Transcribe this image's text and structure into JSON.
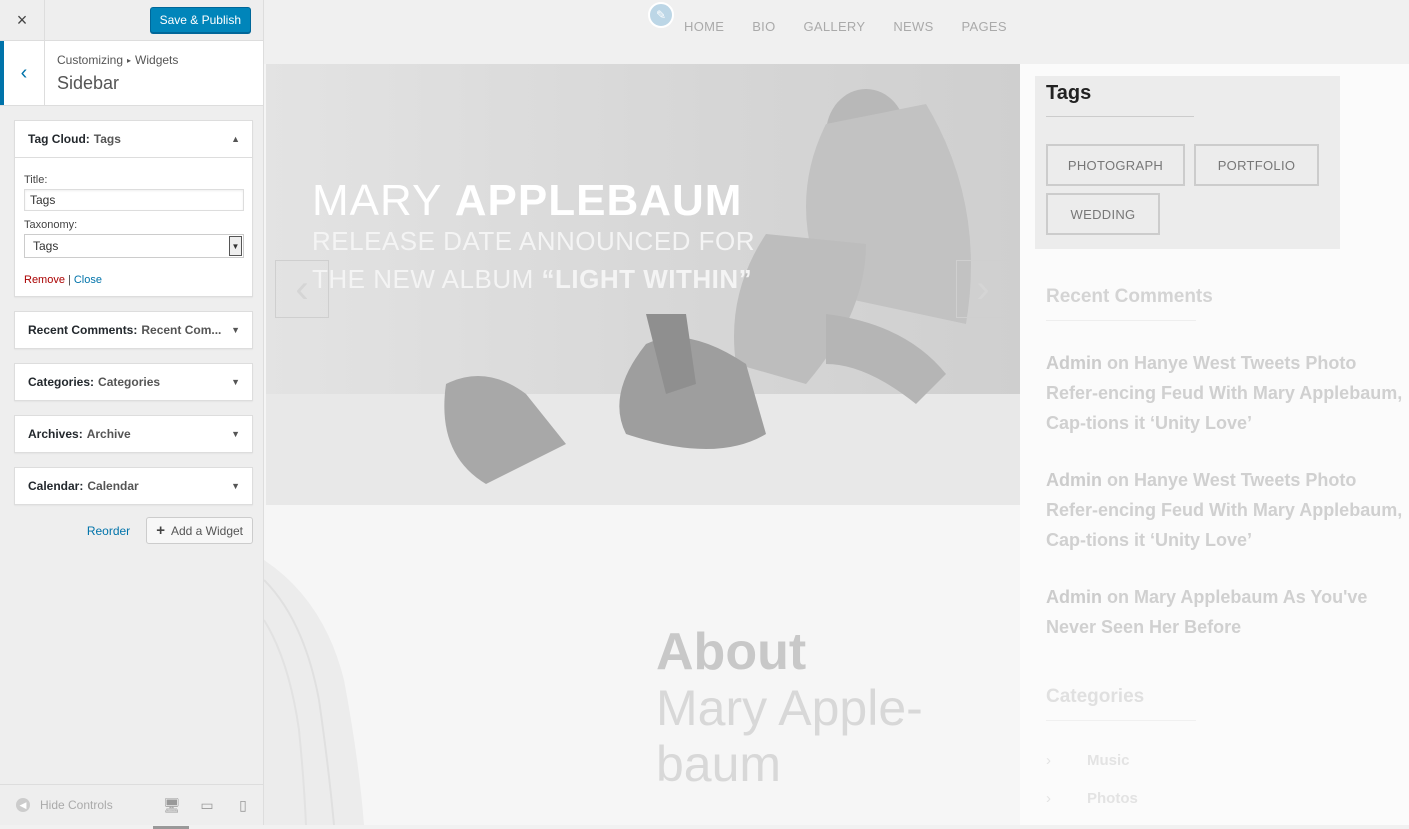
{
  "customizer": {
    "close_icon": "×",
    "save_label": "Save & Publish",
    "back_icon": "‹",
    "breadcrumb": {
      "root": "Customizing",
      "sep": "▸",
      "current": "Widgets"
    },
    "section_title": "Sidebar",
    "widgets": [
      {
        "type": "Tag Cloud",
        "colon": ":",
        "title": "Tags",
        "arrow": "▲",
        "expanded": true
      },
      {
        "type": "Recent Comments",
        "colon": ":",
        "title": "Recent Com...",
        "arrow": "▼"
      },
      {
        "type": "Categories",
        "colon": ":",
        "title": "Categories",
        "arrow": "▼"
      },
      {
        "type": "Archives",
        "colon": ":",
        "title": "Archive",
        "arrow": "▼"
      },
      {
        "type": "Calendar",
        "colon": ":",
        "title": "Calendar",
        "arrow": "▼"
      }
    ],
    "tag_form": {
      "title_label": "Title:",
      "title_value": "Tags",
      "taxonomy_label": "Taxonomy:",
      "taxonomy_value": "Tags",
      "dropdown_arrow": "▼",
      "remove": "Remove",
      "pipe": "|",
      "close": "Close"
    },
    "reorder": "Reorder",
    "add_widget": "Add a Widget",
    "add_plus": "+",
    "hide_controls": "Hide Controls",
    "hide_icon": "◀",
    "devices": {
      "desktop": "🖥",
      "tablet": "▭",
      "mobile": "▯"
    }
  },
  "preview": {
    "edit_icon": "✎",
    "nav": [
      "HOME",
      "BIO",
      "GALLERY",
      "NEWS",
      "PAGES"
    ],
    "hero": {
      "name_light": "MARY",
      "name_bold": "APPLEBAUM",
      "line1": "RELEASE DATE ANNOUNCED FOR",
      "line2_light": "THE NEW ALBUM",
      "line2_bold": "“LIGHT WITHIN”",
      "prev": "‹",
      "next": "›"
    },
    "about": {
      "title": "About",
      "subtitle": "Mary Apple-baum"
    },
    "tags_widget": {
      "title": "Tags",
      "tags": [
        "PHOTOGRAPH",
        "PORTFOLIO",
        "WEDDING"
      ]
    },
    "recent_comments": {
      "title": "Recent Comments",
      "items": [
        {
          "author": "Admin",
          "on": "on",
          "post": "Hanye West Tweets Photo Refer-encing Feud With Mary Applebaum, Cap-tions it ‘Unity Love’"
        },
        {
          "author": "Admin",
          "on": "on",
          "post": "Hanye West Tweets Photo Refer-encing Feud With Mary Applebaum, Cap-tions it ‘Unity Love’"
        },
        {
          "author": "Admin",
          "on": "on",
          "post": "Mary Applebaum As You've Never Seen Her Before"
        }
      ]
    },
    "categories": {
      "title": "Categories",
      "chevron": "›",
      "items": [
        "Music",
        "Photos"
      ]
    }
  }
}
